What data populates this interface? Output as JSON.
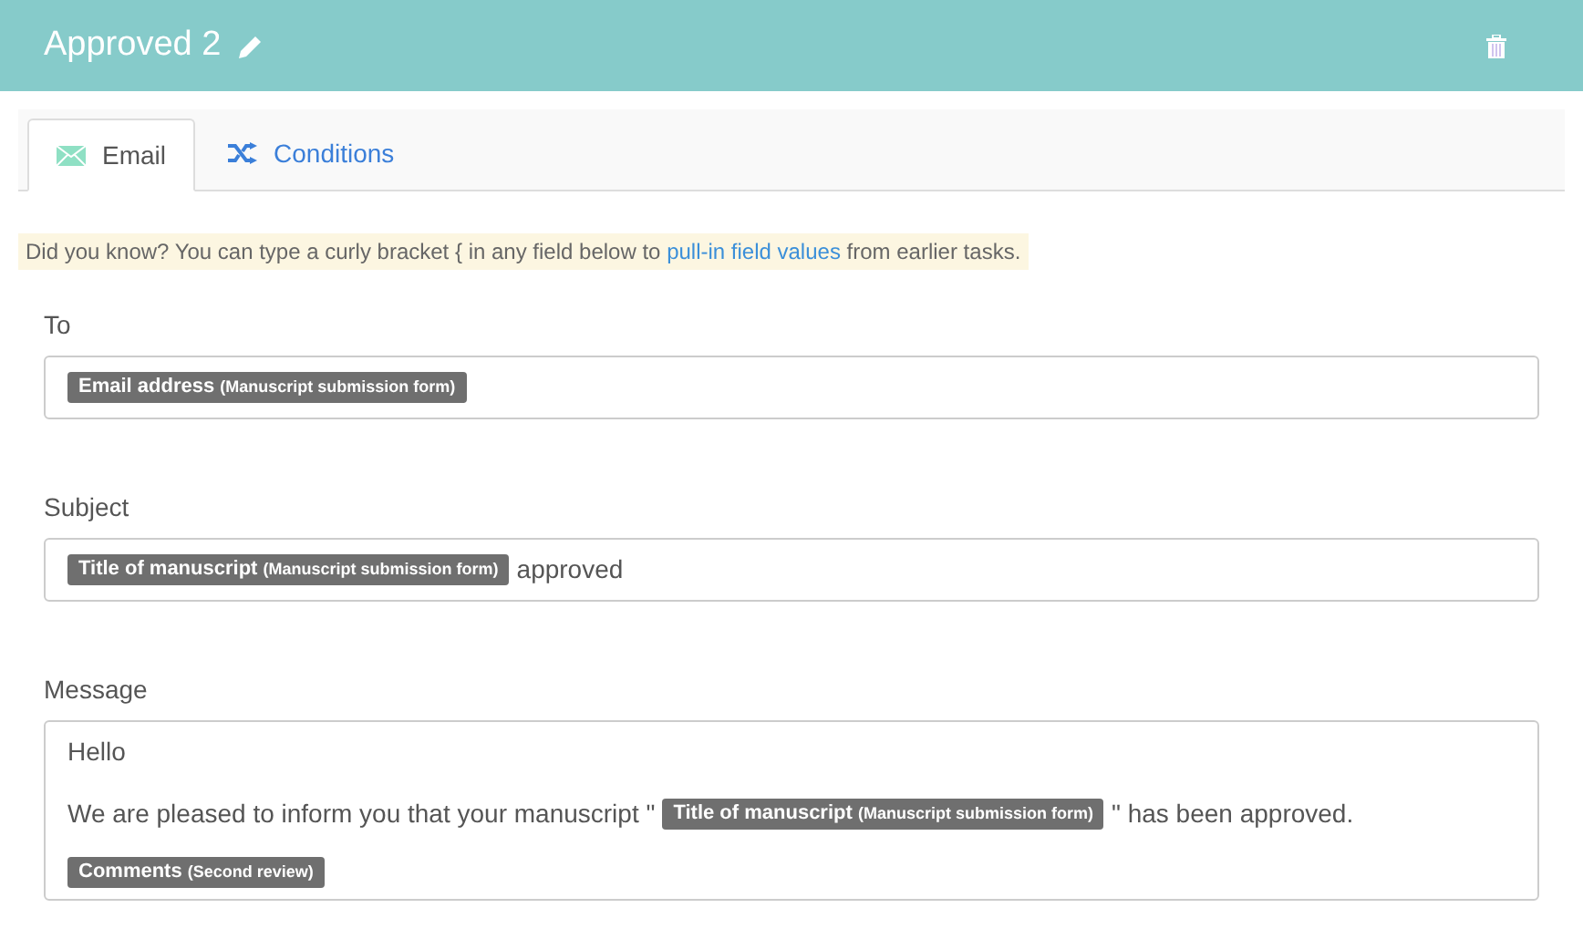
{
  "header": {
    "title": "Approved 2"
  },
  "tabs": [
    {
      "label": "Email",
      "kind": "email",
      "selected": true
    },
    {
      "label": "Conditions",
      "kind": "conditions",
      "selected": false
    }
  ],
  "tip": {
    "text": "Did you know? You can type a curly bracket { in any field below to",
    "link": "pull-in field values",
    "after": "from earlier tasks."
  },
  "fields": [
    {
      "label": "To",
      "kind": "input",
      "lines": [
        [
          {
            "kind": "token",
            "name": "Email address",
            "source": "(Manuscript submission form)"
          }
        ]
      ]
    },
    {
      "label": "Subject",
      "kind": "input",
      "lines": [
        [
          {
            "kind": "token",
            "name": "Title of manuscript",
            "source": "(Manuscript submission form)"
          },
          {
            "kind": "text",
            "text": "approved"
          }
        ]
      ]
    },
    {
      "label": "Message",
      "kind": "textarea",
      "lines": [
        [
          {
            "kind": "text",
            "text": "Hello"
          }
        ],
        [
          {
            "kind": "text",
            "text": "We are pleased to inform you that your manuscript \""
          },
          {
            "kind": "token",
            "name": "Title of manuscript",
            "source": "(Manuscript submission form)"
          },
          {
            "kind": "text",
            "text": "\" has been approved."
          }
        ],
        [
          {
            "kind": "token",
            "name": "Comments",
            "source": "(Second review)"
          }
        ]
      ]
    }
  ]
}
